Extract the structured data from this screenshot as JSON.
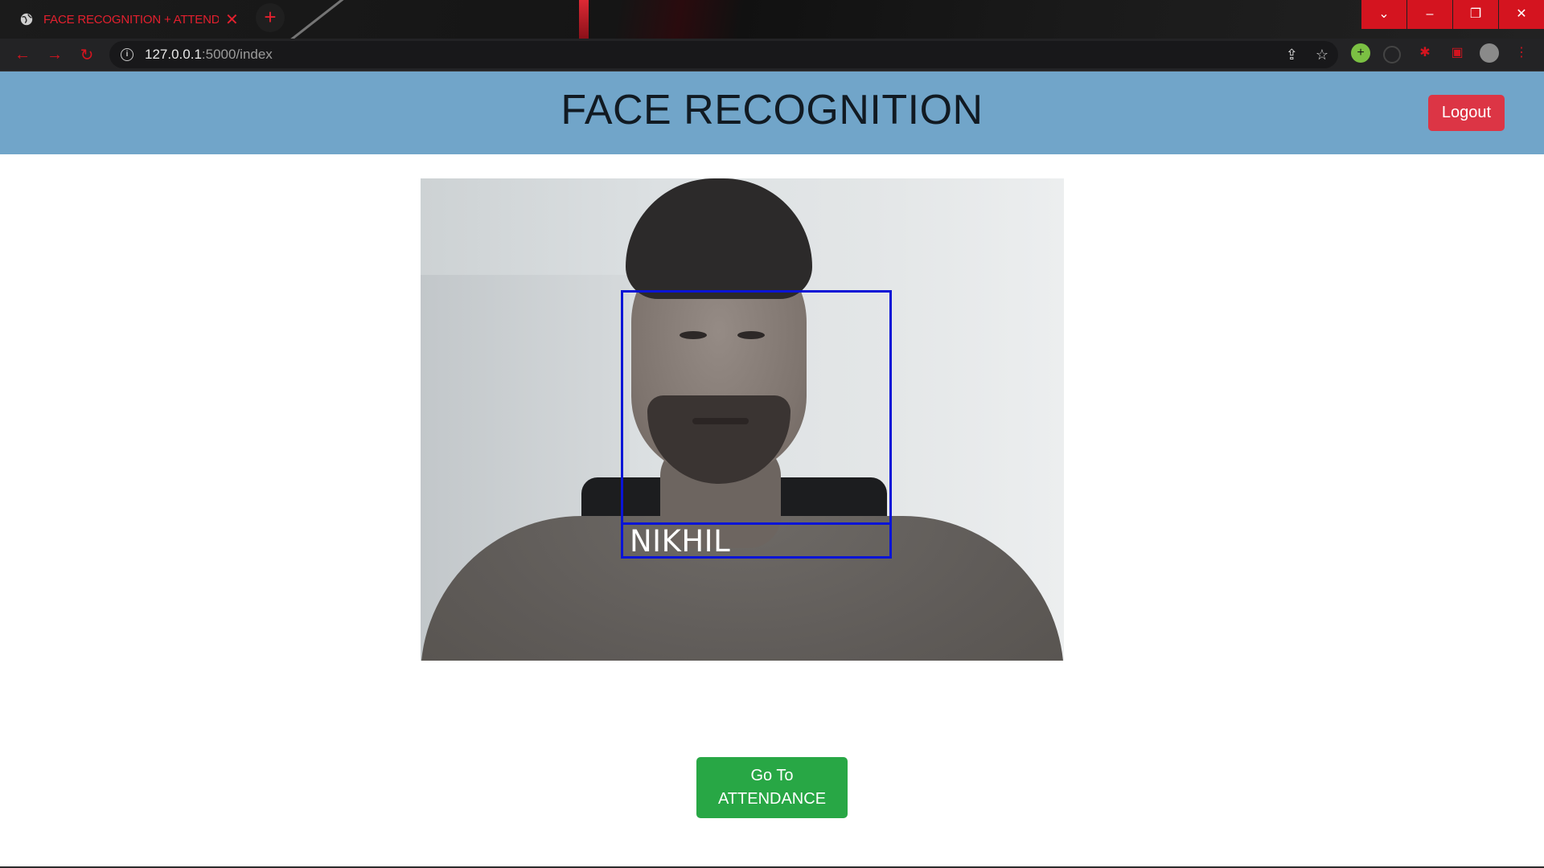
{
  "browser": {
    "tab_title": "FACE RECOGNITION + ATTENDANCE",
    "new_tab_symbol": "+",
    "url_host": "127.0.0.1",
    "url_path": ":5000/index",
    "icons": [
      "globe-icon",
      "close-icon",
      "back-icon",
      "forward-icon",
      "reload-icon",
      "info-icon",
      "share-icon",
      "star-icon",
      "extension-icon",
      "profile-avatar",
      "menu-icon"
    ],
    "accent_color": "#d4141f"
  },
  "header": {
    "title": "FACE RECOGNITION",
    "logout_label": "Logout",
    "background_color": "#71a5c9"
  },
  "video": {
    "detected_name": "NIKHIL",
    "box_color": "#0a14d6"
  },
  "actions": {
    "attendance_line1": "Go To",
    "attendance_line2": "ATTENDANCE",
    "attendance_color": "#28a745",
    "logout_color": "#dc3545"
  }
}
